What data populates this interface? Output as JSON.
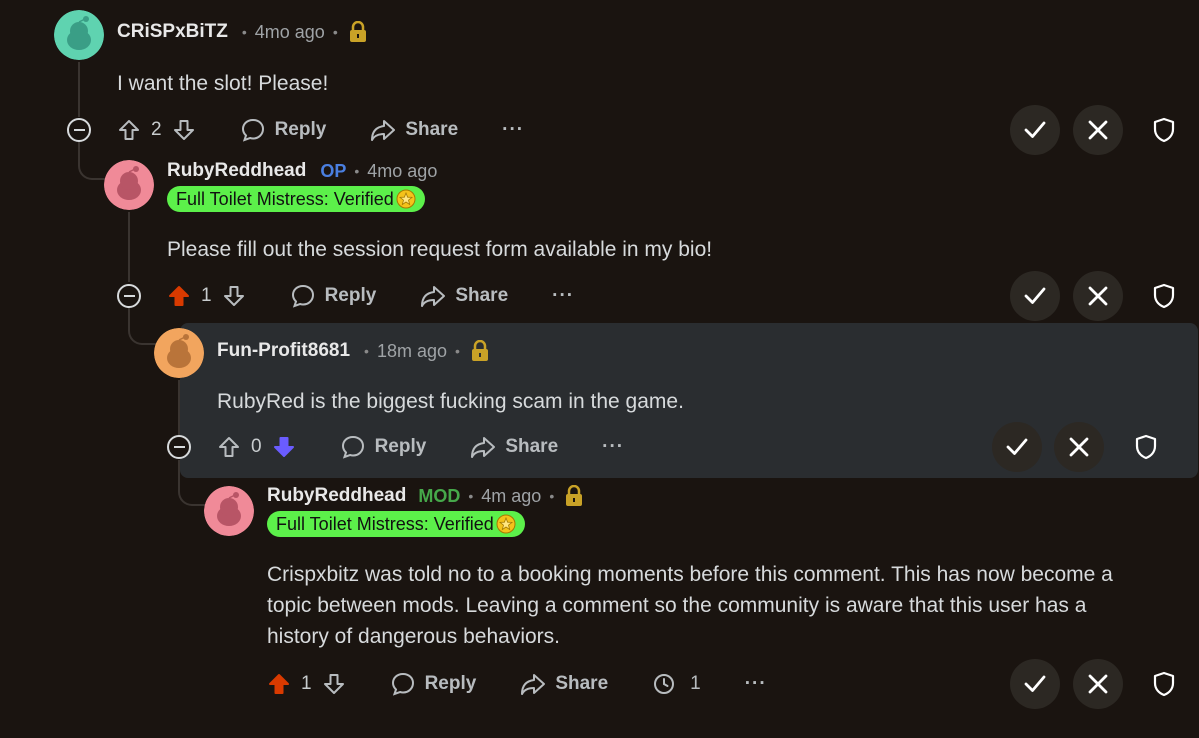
{
  "comments": [
    {
      "username": "CRiSPxBiTZ",
      "time": "4mo ago",
      "body": "I want the slot! Please!",
      "score": "2",
      "vote": "none",
      "avatar_color": "#5fd3b0"
    },
    {
      "username": "RubyReddhead",
      "tag": "OP",
      "time": "4mo ago",
      "flair": "Full Toilet Mistress: Verified",
      "body": "Please fill out the session request form available in my bio!",
      "score": "1",
      "vote": "up",
      "avatar_color": "#f08a98"
    },
    {
      "username": "Fun-Profit8681",
      "time": "18m ago",
      "body": "RubyRed is the biggest fucking scam in the game.",
      "score": "0",
      "vote": "down",
      "avatar_color": "#f2a55e"
    },
    {
      "username": "RubyReddhead",
      "tag": "MOD",
      "time": "4m ago",
      "flair": "Full Toilet Mistress: Verified",
      "body_lines": [
        "Crispxbitz was told no to a booking moments before this comment. This has now become a",
        "topic between mods. Leaving a comment so the community is aware that this user has a",
        "history of dangerous behaviors."
      ],
      "score": "1",
      "vote": "up",
      "reports": "1",
      "avatar_color": "#f08a98"
    }
  ],
  "labels": {
    "reply": "Reply",
    "share": "Share",
    "more": "···"
  },
  "colors": {
    "upvote_active": "#d93a00",
    "downvote_active": "#6a5cff",
    "flair_bg": "#5cf04a",
    "op_tag": "#4a7fe0",
    "mod_tag": "#46a84a"
  }
}
